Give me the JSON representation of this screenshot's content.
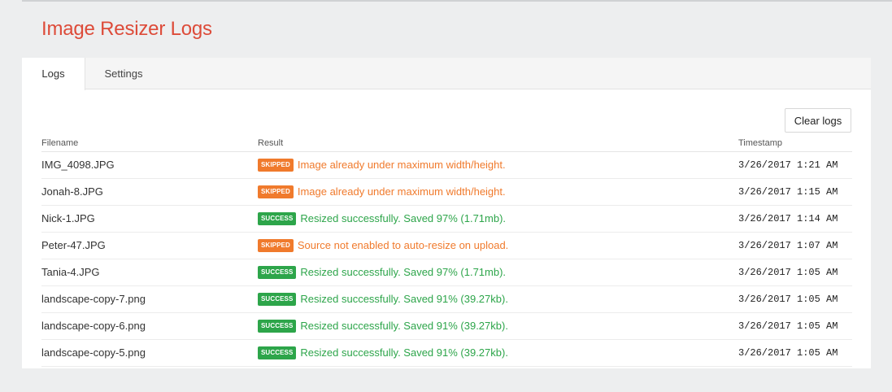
{
  "page": {
    "title": "Image Resizer Logs"
  },
  "tabs": [
    {
      "label": "Logs",
      "active": true
    },
    {
      "label": "Settings",
      "active": false
    }
  ],
  "toolbar": {
    "clear_label": "Clear logs"
  },
  "colors": {
    "title": "#dd4b39",
    "skipped": "#f07a2c",
    "success": "#2da54a"
  },
  "table": {
    "headers": {
      "filename": "Filename",
      "result": "Result",
      "timestamp": "Timestamp"
    },
    "rows": [
      {
        "filename": "IMG_4098.JPG",
        "status": "skipped",
        "badge": "SKIPPED",
        "message": "Image already under maximum width/height.",
        "timestamp": "3/26/2017 1:21 AM"
      },
      {
        "filename": "Jonah-8.JPG",
        "status": "skipped",
        "badge": "SKIPPED",
        "message": "Image already under maximum width/height.",
        "timestamp": "3/26/2017 1:15 AM"
      },
      {
        "filename": "Nick-1.JPG",
        "status": "success",
        "badge": "SUCCESS",
        "message": "Resized successfully. Saved 97% (1.71mb).",
        "timestamp": "3/26/2017 1:14 AM"
      },
      {
        "filename": "Peter-47.JPG",
        "status": "skipped",
        "badge": "SKIPPED",
        "message": "Source not enabled to auto-resize on upload.",
        "timestamp": "3/26/2017 1:07 AM"
      },
      {
        "filename": "Tania-4.JPG",
        "status": "success",
        "badge": "SUCCESS",
        "message": "Resized successfully. Saved 97% (1.71mb).",
        "timestamp": "3/26/2017 1:05 AM"
      },
      {
        "filename": "landscape-copy-7.png",
        "status": "success",
        "badge": "SUCCESS",
        "message": "Resized successfully. Saved 91% (39.27kb).",
        "timestamp": "3/26/2017 1:05 AM"
      },
      {
        "filename": "landscape-copy-6.png",
        "status": "success",
        "badge": "SUCCESS",
        "message": "Resized successfully. Saved 91% (39.27kb).",
        "timestamp": "3/26/2017 1:05 AM"
      },
      {
        "filename": "landscape-copy-5.png",
        "status": "success",
        "badge": "SUCCESS",
        "message": "Resized successfully. Saved 91% (39.27kb).",
        "timestamp": "3/26/2017 1:05 AM"
      }
    ]
  }
}
